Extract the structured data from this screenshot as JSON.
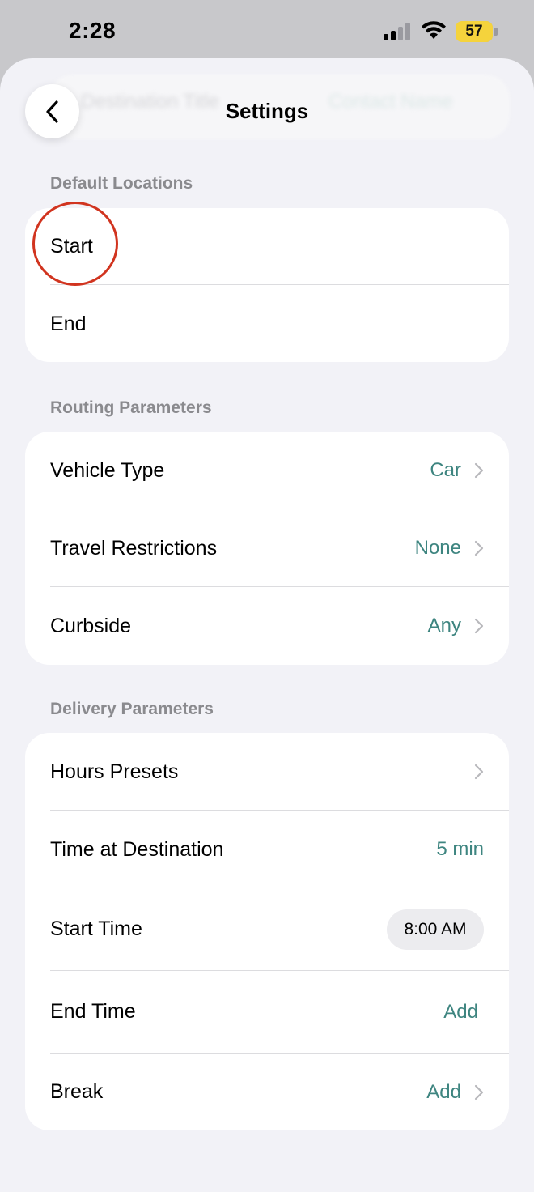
{
  "status_bar": {
    "time": "2:28",
    "battery": "57"
  },
  "nav": {
    "title": "Settings",
    "ghost_left": "Destination Title",
    "ghost_right": "Contact Name"
  },
  "sections": {
    "default_locations": {
      "header": "Default Locations",
      "start_label": "Start",
      "end_label": "End"
    },
    "routing": {
      "header": "Routing Parameters",
      "vehicle_label": "Vehicle Type",
      "vehicle_value": "Car",
      "travel_label": "Travel Restrictions",
      "travel_value": "None",
      "curbside_label": "Curbside",
      "curbside_value": "Any"
    },
    "delivery": {
      "header": "Delivery Parameters",
      "hours_label": "Hours Presets",
      "time_dest_label": "Time at Destination",
      "time_dest_value": "5 min",
      "start_time_label": "Start Time",
      "start_time_value": "8:00 AM",
      "end_time_label": "End Time",
      "end_time_value": "Add",
      "break_label": "Break",
      "break_value": "Add"
    }
  },
  "colors": {
    "accent": "#3e8580",
    "highlight": "#d1341f",
    "background": "#f2f2f7",
    "battery": "#f5d33c"
  }
}
